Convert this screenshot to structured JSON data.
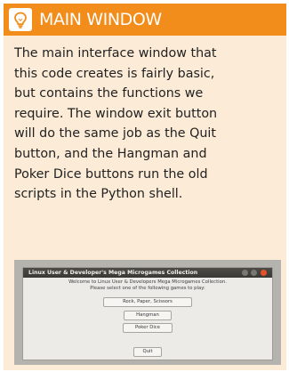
{
  "header": {
    "title": "MAIN WINDOW",
    "icon": "lightbulb-icon",
    "accent_color": "#f28c1a",
    "panel_color": "#fcebd7"
  },
  "body": {
    "lines": [
      "The main interface window that",
      "this code creates is fairly basic,",
      "but contains the functions we",
      "require. The window exit button",
      "will do the same job as the Quit",
      "button, and the Hangman and",
      "Poker Dice buttons run the old",
      "scripts in the Python shell."
    ]
  },
  "screenshot": {
    "window_title": "Linux User & Developer's Mega Microgames Collection",
    "welcome_line1": "Welcome to Linux User & Developers Mega Microgames Collection.",
    "welcome_line2": "Please select one of the following games to play:",
    "buttons": [
      "Rock, Paper, Scissors",
      "Hangman",
      "Poker Dice",
      "Quit"
    ]
  }
}
